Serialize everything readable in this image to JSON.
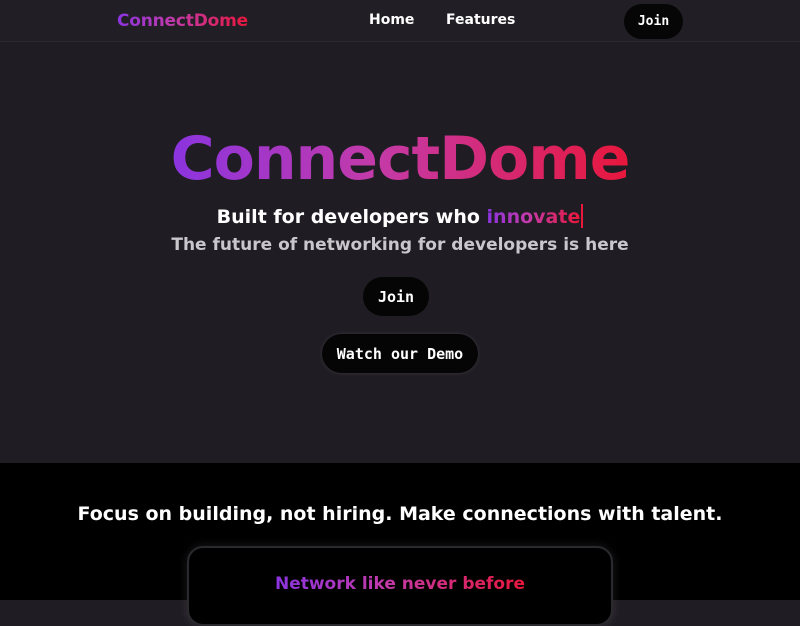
{
  "navbar": {
    "brand": "ConnectDome",
    "links": [
      "Home",
      "Features"
    ],
    "join_label": "Join"
  },
  "hero": {
    "title": "ConnectDome",
    "tagline_prefix": "Built for developers who ",
    "tagline_typed": "innovate",
    "subtitle": "The future of networking for developers is here",
    "join_label": "Join",
    "demo_label": "Watch our Demo"
  },
  "features": {
    "headline": "Focus on building, not hiring. Make connections with talent.",
    "card_title": "Network like never before"
  },
  "colors": {
    "gradient_start": "#8b34e0",
    "gradient_mid": "#c43aa8",
    "gradient_end": "#e8173c",
    "hero_bg": "#1f1d23",
    "section_bg": "#000000",
    "button_bg": "#050505"
  }
}
